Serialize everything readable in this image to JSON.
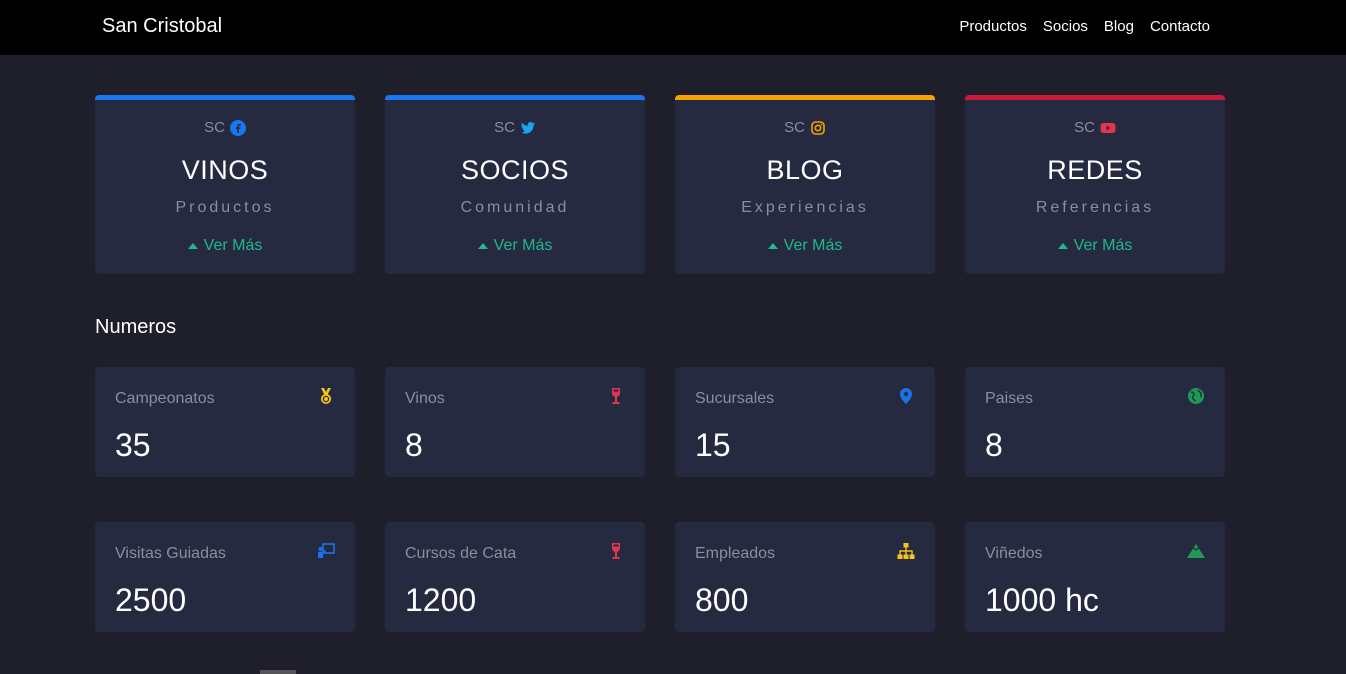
{
  "navbar": {
    "brand": "San Cristobal",
    "links": [
      "Productos",
      "Socios",
      "Blog",
      "Contacto"
    ]
  },
  "top_cards": [
    {
      "sc": "SC",
      "icon": "facebook-icon",
      "title": "VINOS",
      "subtitle": "Productos",
      "more": "Ver Más",
      "color": "#1877f2"
    },
    {
      "sc": "SC",
      "icon": "twitter-icon",
      "title": "SOCIOS",
      "subtitle": "Comunidad",
      "more": "Ver Más",
      "color": "#1da1f2"
    },
    {
      "sc": "SC",
      "icon": "instagram-icon",
      "title": "BLOG",
      "subtitle": "Experiencias",
      "more": "Ver Más",
      "color": "#f5a300"
    },
    {
      "sc": "SC",
      "icon": "youtube-icon",
      "title": "REDES",
      "subtitle": "Referencias",
      "more": "Ver Más",
      "color": "#cc1a3a"
    }
  ],
  "section_title": "Numeros",
  "stats": [
    {
      "label": "Campeonatos",
      "value": "35",
      "icon": "medal-icon",
      "color": "#f5c518"
    },
    {
      "label": "Vinos",
      "value": "8",
      "icon": "wine-glass-icon",
      "color": "#e0364f"
    },
    {
      "label": "Sucursales",
      "value": "15",
      "icon": "map-pin-icon",
      "color": "#1a73e8"
    },
    {
      "label": "Paises",
      "value": "8",
      "icon": "globe-icon",
      "color": "#1e9a55"
    },
    {
      "label": "Visitas Guiadas",
      "value": "2500",
      "icon": "presentation-icon",
      "color": "#1a73e8"
    },
    {
      "label": "Cursos de Cata",
      "value": "1200",
      "icon": "wine-glass-icon",
      "color": "#e0364f"
    },
    {
      "label": "Empleados",
      "value": "800",
      "icon": "org-chart-icon",
      "color": "#f5c518"
    },
    {
      "label": "Viñedos",
      "value": "1000 hc",
      "icon": "mountain-icon",
      "color": "#1e9a55"
    }
  ]
}
